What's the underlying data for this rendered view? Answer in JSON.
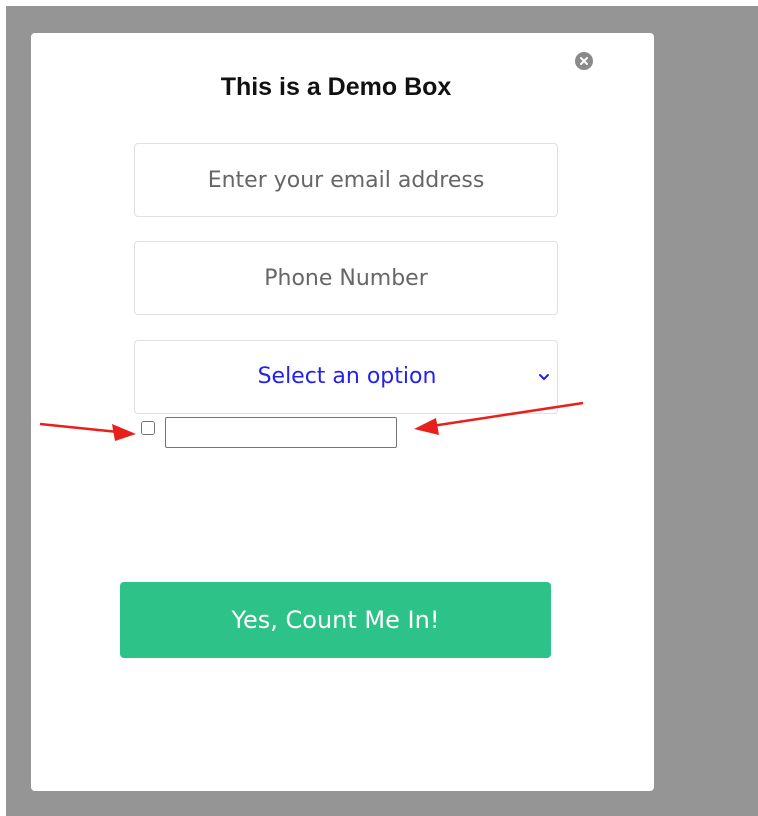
{
  "modal": {
    "title": "This is a Demo Box",
    "close_icon": "close-icon"
  },
  "form": {
    "email": {
      "value": "",
      "placeholder": "Enter your email address"
    },
    "phone": {
      "value": "",
      "placeholder": "Phone Number"
    },
    "select": {
      "selected": "Select an option",
      "icon": "chevron-down-icon"
    },
    "checkbox": {
      "checked": false
    },
    "text_input": {
      "value": ""
    },
    "submit_label": "Yes, Count Me In!"
  },
  "annotations": {
    "arrow_icon": "red-arrow-icon"
  },
  "colors": {
    "overlay": "#959595",
    "submit_bg": "#2dc287",
    "select_text": "#2222ee",
    "arrow": "#e8201c",
    "close_bg": "#8a8a8a"
  }
}
